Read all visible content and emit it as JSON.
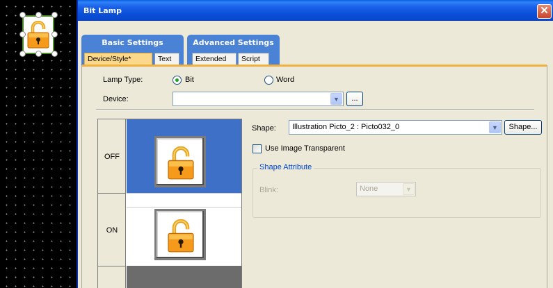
{
  "dialog": {
    "title": "Bit Lamp",
    "close_symbol": "✕"
  },
  "tab_groups": {
    "basic": {
      "label": "Basic Settings",
      "tabs": [
        {
          "label": "Device/Style*",
          "active": true
        },
        {
          "label": "Text",
          "active": false
        }
      ]
    },
    "advanced": {
      "label": "Advanced Settings",
      "tabs": [
        {
          "label": "Extended",
          "active": false
        },
        {
          "label": "Script",
          "active": false
        }
      ]
    }
  },
  "form": {
    "lamp_type_label": "Lamp Type:",
    "lamp_type_options": [
      {
        "label": "Bit",
        "selected": true
      },
      {
        "label": "Word",
        "selected": false
      }
    ],
    "device_label": "Device:",
    "device_value": "",
    "browse_button_label": "..."
  },
  "state_table": {
    "rows": [
      {
        "label": "OFF"
      },
      {
        "label": "ON"
      }
    ]
  },
  "shape": {
    "label": "Shape:",
    "value": "Illustration Picto_2 : Picto032_0",
    "button_label": "Shape...",
    "use_transparent_label": "Use Image Transparent",
    "use_transparent_checked": false
  },
  "shape_attribute": {
    "title": "Shape Attribute",
    "blink_label": "Blink:",
    "blink_value": "None"
  },
  "colors": {
    "titlebar": "#0a4fd8",
    "tab_group": "#4a82d6",
    "active_tab": "#fbd88a",
    "selected_row": "#3e70c8",
    "lamp_body": "#f59a1a",
    "lamp_shackle": "#f7b830"
  },
  "icons": {
    "lamp": "open-padlock-icon",
    "combo_arrow": "chevron-down-icon",
    "close": "close-icon"
  }
}
